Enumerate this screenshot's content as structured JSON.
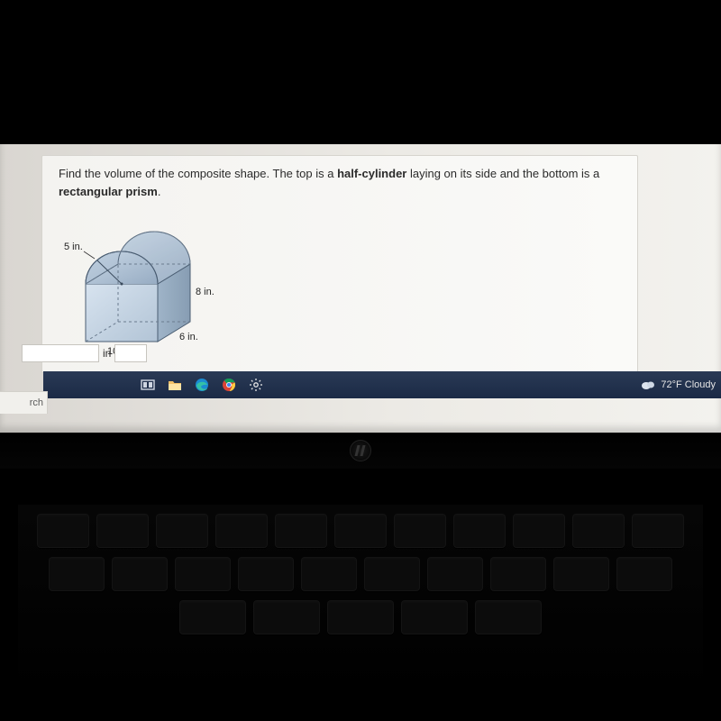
{
  "question": {
    "prefix": "Find the volume of the composite shape. The top is a ",
    "bold1": "half-cylinder",
    "mid": " laying on its side and the bottom is a ",
    "bold2": "rectangular prism",
    "suffix": "."
  },
  "diagram": {
    "radius_label": "5 in.",
    "height_label": "8 in.",
    "width_label": "6 in.",
    "length_label": "10 in."
  },
  "answer": {
    "value": "",
    "unit": "in",
    "exponent": ""
  },
  "taskbar": {
    "weather": "72°F  Cloudy"
  },
  "search_fragment": "rch",
  "chart_data": {
    "type": "diagram",
    "shape": "composite",
    "components": [
      {
        "shape": "rectangular_prism",
        "length_in": 10,
        "width_in": 6,
        "height_in": 8
      },
      {
        "shape": "half_cylinder",
        "radius_in": 5,
        "length_in": 6,
        "orientation": "laying on side on top of prism"
      }
    ],
    "labels": [
      "5 in.",
      "8 in.",
      "6 in.",
      "10 in."
    ],
    "answer_unit": "in^3"
  }
}
